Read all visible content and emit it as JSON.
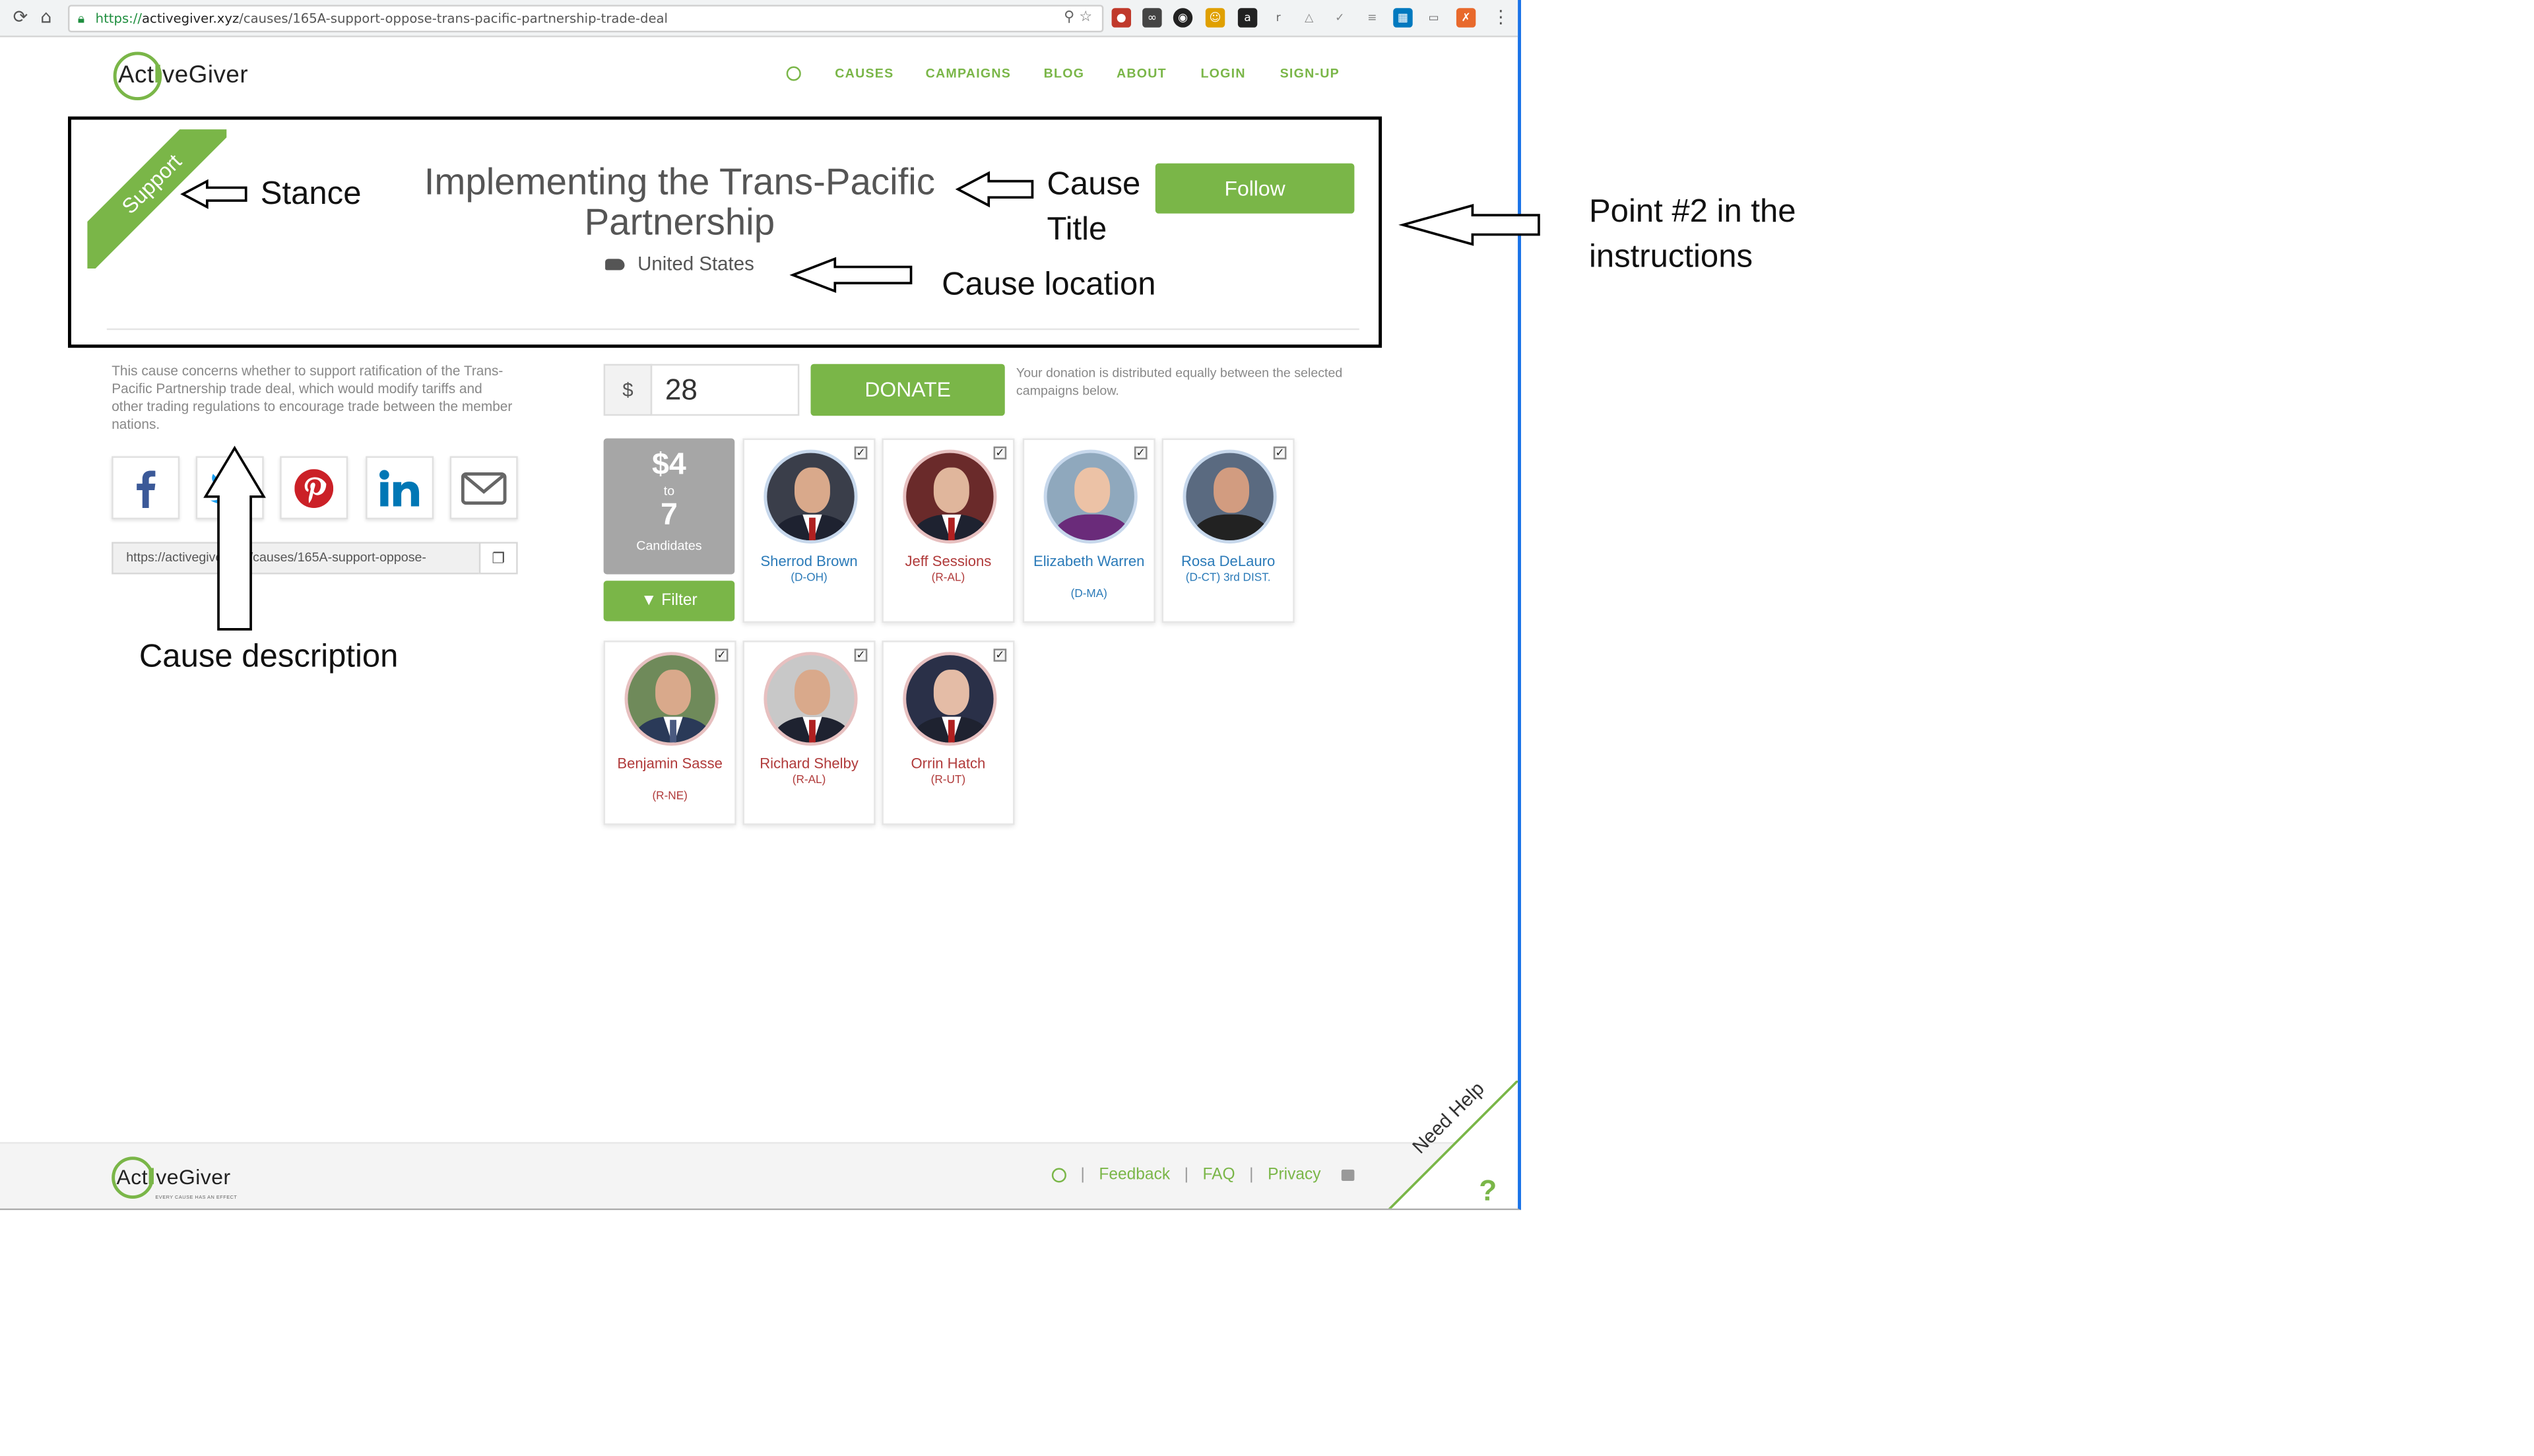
{
  "browser": {
    "url_scheme": "https://",
    "url_domain": "activegiver.xyz",
    "url_path": "/causes/165A-support-oppose-trans-pacific-partnership-trade-deal"
  },
  "site": {
    "logo_text_left": "Act",
    "logo_text_right": "veGiver",
    "footer_tagline": "EVERY CAUSE HAS AN EFFECT",
    "nav": [
      "CAUSES",
      "CAMPAIGNS",
      "BLOG",
      "ABOUT",
      "LOGIN",
      "SIGN-UP"
    ]
  },
  "cause": {
    "stance": "Support",
    "title": "Implementing the Trans-Pacific Partnership",
    "location": "United States",
    "follow_label": "Follow",
    "description": "This cause concerns whether to support ratification of the Trans-Pacific Partnership trade deal, which would modify tariffs and other trading regulations to encourage trade between the member nations.",
    "share_link": "https://activegiver.xyz/causes/165A-support-oppose-"
  },
  "donation": {
    "currency_symbol": "$",
    "amount": "28",
    "donate_label": "DONATE",
    "note": "Your donation is distributed equally between the selected campaigns below.",
    "per_candidate": "$4",
    "to_label": "to",
    "candidate_count": "7",
    "candidates_label": "Candidates",
    "filter_label": "Filter"
  },
  "candidates": [
    {
      "name": "Sherrod Brown",
      "party": "(D-OH)",
      "checked": true
    },
    {
      "name": "Jeff Sessions",
      "party": "(R-AL)",
      "checked": true
    },
    {
      "name": "Elizabeth Warren",
      "party": "(D-MA)",
      "checked": true
    },
    {
      "name": "Rosa DeLauro",
      "party": "(D-CT) 3rd DIST.",
      "checked": true
    },
    {
      "name": "Benjamin Sasse",
      "party": "(R-NE)",
      "checked": true
    },
    {
      "name": "Richard Shelby",
      "party": "(R-AL)",
      "checked": true
    },
    {
      "name": "Orrin Hatch",
      "party": "(R-UT)",
      "checked": true
    }
  ],
  "footer": {
    "links": [
      "Feedback",
      "FAQ",
      "Privacy"
    ],
    "separator": "|",
    "need_help": "Need Help"
  },
  "annotations": {
    "stance": "Stance",
    "cause_title_1": "Cause",
    "cause_title_2": "Title",
    "cause_location": "Cause location",
    "cause_description": "Cause description",
    "point_1": "Point #2 in the",
    "point_2": "instructions"
  },
  "colors": {
    "brand_green": "#7ab648",
    "democrat_blue": "#2a7ab8",
    "republican_red": "#b03a3a"
  }
}
